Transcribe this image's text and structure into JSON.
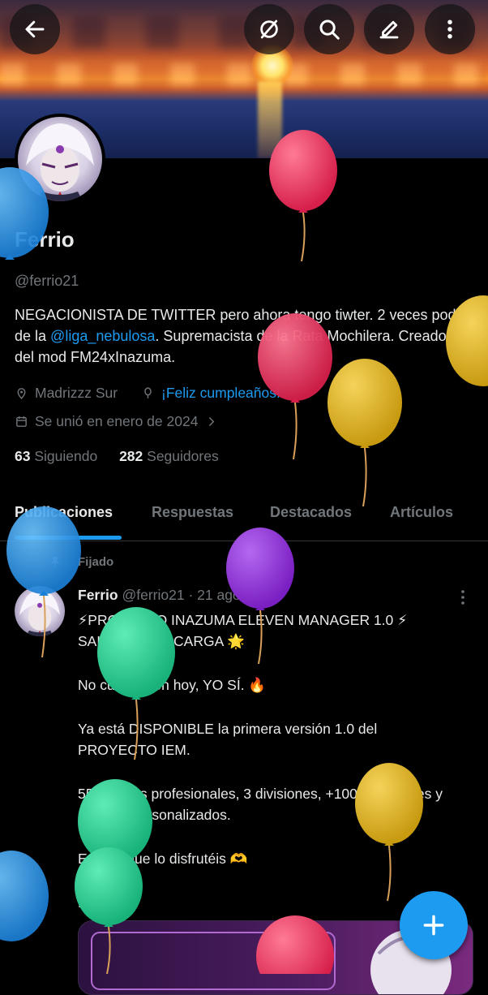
{
  "profile": {
    "name": "Ferrio",
    "handle": "@ferrio21",
    "bio_part1": "NEGACIONISTA DE TWITTER pero ahora tengo tiwter. 2 veces podio de la ",
    "bio_mention": "@liga_nebulosa",
    "bio_part2": ". Supremacista de la Rata Mochilera. Creador del mod FM24xInazuma.",
    "location": "Madrizzz Sur",
    "birthday": "¡Feliz cumpleaños!",
    "joined": "Se unió en enero de 2024",
    "following_count": "63",
    "following_label": "Siguiendo",
    "followers_count": "282",
    "followers_label": "Seguidores"
  },
  "tabs": [
    "Publicaciones",
    "Respuestas",
    "Destacados",
    "Artículos"
  ],
  "post": {
    "pinned_label": "Fijado",
    "author": "Ferrio",
    "meta": "@ferrio21 · 21 ago 25",
    "line1": "⚡PROYECTO INAZUMA ELEVEN MANAGER 1.0 ⚡ SALIDA Y DESCARGA 🌟",
    "line2": "No cumplieron hoy, YO SÍ. 🔥",
    "line3": "Ya está DISPONIBLE la primera versión 1.0 del PROYECTO IEM.",
    "line4": "55 equipos profesionales, 3 divisiones, +1000 jugadores y gráficos personalizados.",
    "line5": "Espero que lo disfrutéis 🫶",
    "line6": "LINKS 👇"
  },
  "icons": {
    "back": "arrow-left-icon",
    "no_retweets": "slash-circle-icon",
    "search": "search-icon",
    "edit": "pencil-icon",
    "more": "more-vertical-icon",
    "location": "location-pin-icon",
    "birthday": "balloon-icon",
    "calendar": "calendar-icon",
    "compose": "plus-icon"
  },
  "colors": {
    "accent": "#1d9bf0",
    "background": "#000000",
    "text": "#e7e9ea",
    "muted": "#71767b"
  }
}
